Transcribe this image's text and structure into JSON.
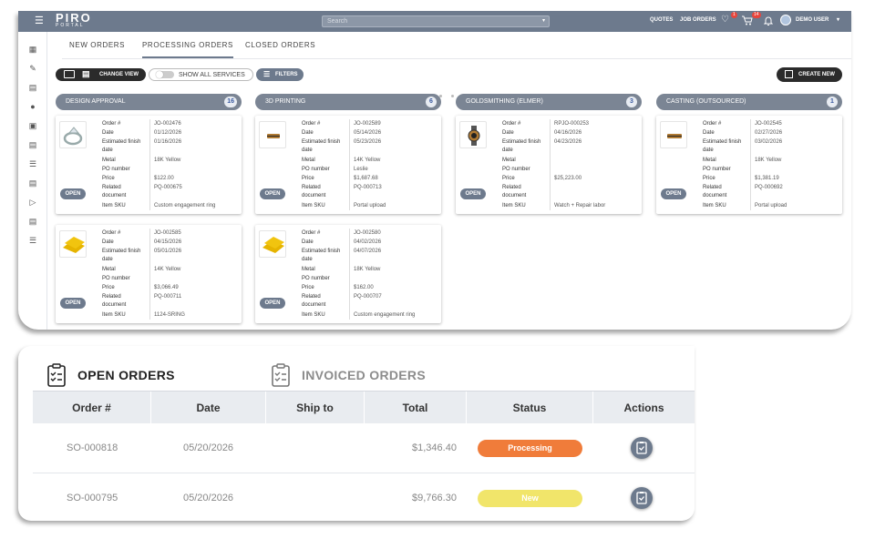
{
  "topbar": {
    "logo": "PIRO",
    "logo_sub": "PORTAL",
    "search_placeholder": "Search",
    "nav": [
      "QUOTES",
      "JOB ORDERS"
    ],
    "wishlist_badge": "1",
    "cart_badge": "14",
    "user": "DEMO USER"
  },
  "tabs": [
    "NEW ORDERS",
    "PROCESSING ORDERS",
    "CLOSED ORDERS"
  ],
  "toolbar": {
    "change_view": "CHANGE VIEW",
    "show_all": "SHOW ALL SERVICES",
    "filters": "FILTERS",
    "create_new": "CREATE NEW"
  },
  "field_labels": [
    "Order #",
    "Date",
    "Estimated finish",
    "date",
    "Metal",
    "PO number",
    "Price",
    "Related",
    "document",
    "Item SKU"
  ],
  "open_label": "OPEN",
  "columns": [
    {
      "title": "DESIGN APPROVAL",
      "count": "16"
    },
    {
      "title": "3D PRINTING",
      "count": "6"
    },
    {
      "title": "GOLDSMITHING (ELMER)",
      "count": "3"
    },
    {
      "title": "CASTING (OUTSOURCED)",
      "count": "1"
    }
  ],
  "cards": [
    {
      "order": "JO-002476",
      "date": "01/12/2026",
      "finish": "01/16/2026",
      "metal": "18K Yellow",
      "po": "",
      "price": "$122.00",
      "related": "PQ-000675",
      "sku": "Custom engagement ring"
    },
    {
      "order": "JO-002589",
      "date": "05/14/2026",
      "finish": "05/23/2026",
      "metal": "14K Yellow",
      "po": "Leslie",
      "price": "$1,687.68",
      "related": "PQ-000713",
      "sku": "Portal upload"
    },
    {
      "order": "RPJO-000253",
      "date": "04/16/2026",
      "finish": "04/23/2026",
      "metal": "",
      "po": "",
      "price": "$25,223.00",
      "related": "",
      "sku": "Watch + Repair labor"
    },
    {
      "order": "JO-002545",
      "date": "02/27/2026",
      "finish": "03/02/2026",
      "metal": "18K Yellow",
      "po": "",
      "price": "$1,381.19",
      "related": "PQ-000692",
      "sku": "Portal upload"
    },
    {
      "order": "JO-002585",
      "date": "04/15/2026",
      "finish": "05/01/2026",
      "metal": "14K Yellow",
      "po": "",
      "price": "$3,066.49",
      "related": "PQ-000711",
      "sku": "1124-SRING"
    },
    {
      "order": "JO-002580",
      "date": "04/02/2026",
      "finish": "04/07/2026",
      "metal": "18K Yellow",
      "po": "",
      "price": "$162.00",
      "related": "PQ-000707",
      "sku": "Custom engagement ring"
    }
  ],
  "orders": {
    "tab_open": "OPEN ORDERS",
    "tab_invoiced": "INVOICED ORDERS",
    "headers": [
      "Order #",
      "Date",
      "Ship to",
      "Total",
      "Status",
      "Actions"
    ],
    "rows": [
      {
        "order": "SO-000818",
        "date": "05/20/2026",
        "ship": "",
        "total": "$1,346.40",
        "status": "Processing",
        "status_color": "#f07c3a"
      },
      {
        "order": "SO-000795",
        "date": "05/20/2026",
        "ship": "",
        "total": "$9,766.30",
        "status": "New",
        "status_color": "#f1e56a"
      }
    ]
  }
}
